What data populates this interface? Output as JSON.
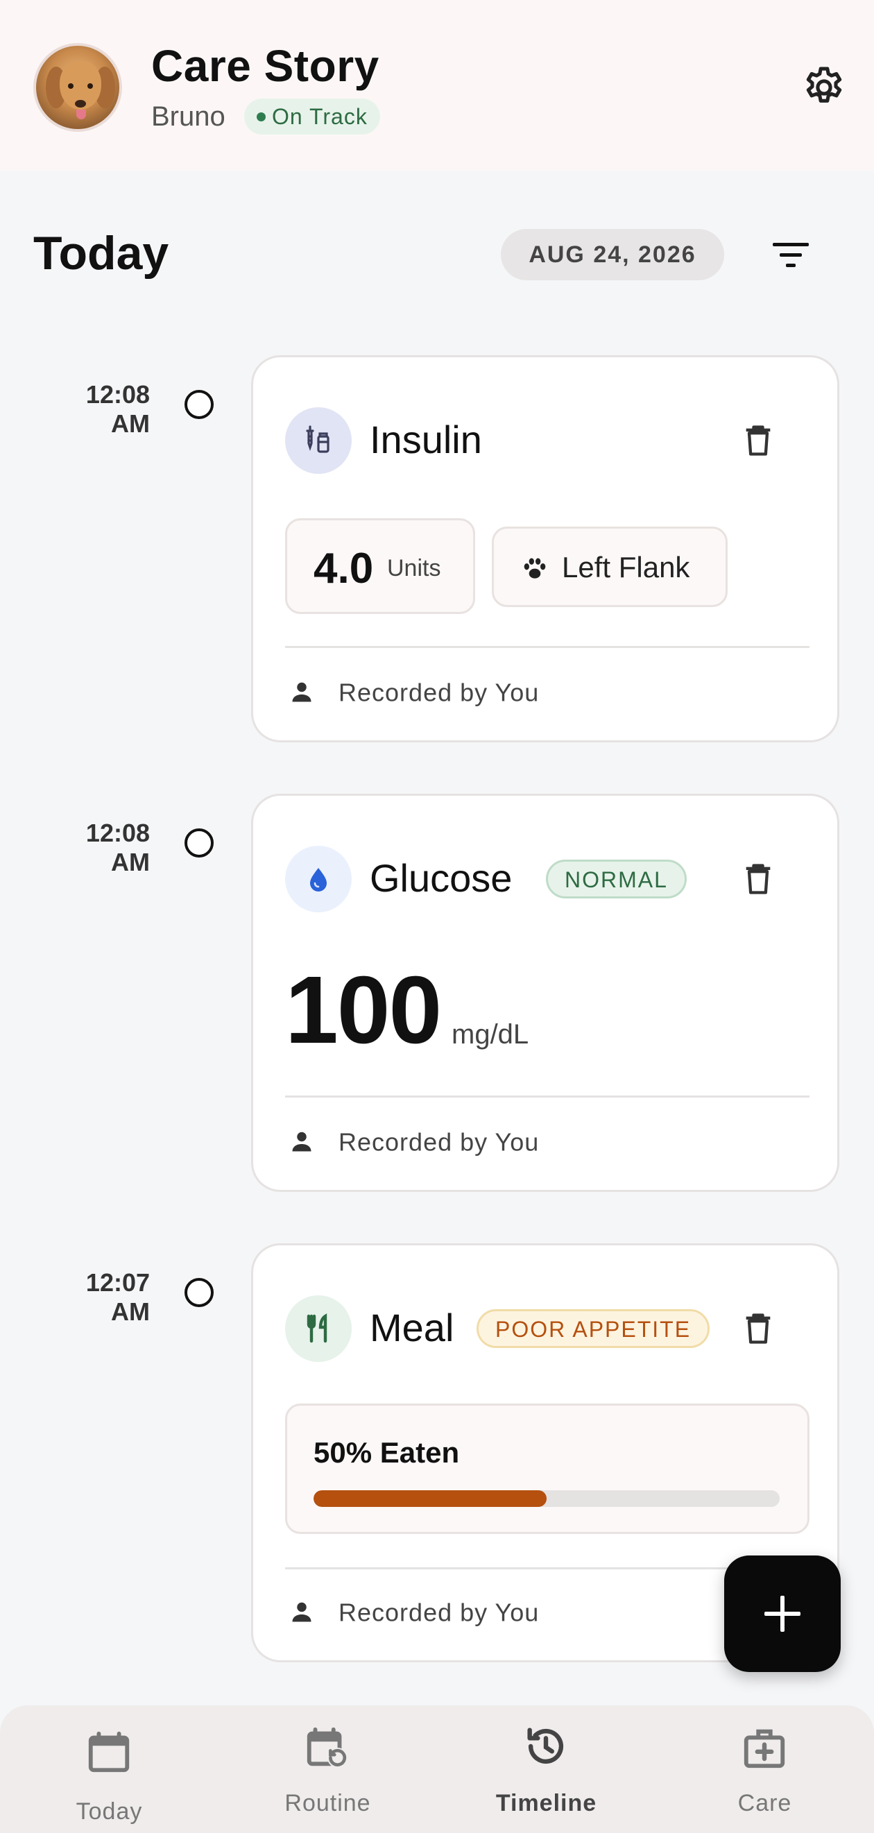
{
  "header": {
    "title": "Care Story",
    "pet_name": "Bruno",
    "status": "On Track",
    "icons": {
      "avatar": "dog-photo",
      "settings": "gear-icon"
    }
  },
  "section": {
    "title": "Today",
    "date": "AUG 24, 2026",
    "icons": {
      "filter": "filter-icon"
    }
  },
  "entries": [
    {
      "time_line1": "12:08",
      "time_line2": "AM",
      "type": "Insulin",
      "icon": "syringe-vial-icon",
      "dose_value": "4.0",
      "dose_unit": "Units",
      "site": "Left Flank",
      "site_icon": "paw-icon",
      "recorded_by": "Recorded by You"
    },
    {
      "time_line1": "12:08",
      "time_line2": "AM",
      "type": "Glucose",
      "icon": "droplet-icon",
      "badge": "NORMAL",
      "value": "100",
      "unit": "mg/dL",
      "recorded_by": "Recorded by You"
    },
    {
      "time_line1": "12:07",
      "time_line2": "AM",
      "type": "Meal",
      "icon": "fork-knife-icon",
      "badge": "POOR APPETITE",
      "eaten_label": "50% Eaten",
      "eaten_fraction": 0.5,
      "recorded_by": "Recorded by You"
    }
  ],
  "fab": {
    "icon": "plus-icon"
  },
  "nav": {
    "items": [
      {
        "label": "Today",
        "icon": "calendar-icon",
        "active": false
      },
      {
        "label": "Routine",
        "icon": "calendar-repeat-icon",
        "active": false
      },
      {
        "label": "Timeline",
        "icon": "history-icon",
        "active": true
      },
      {
        "label": "Care",
        "icon": "medical-kit-icon",
        "active": false
      }
    ]
  },
  "colors": {
    "header_bg": "#fcf7f6",
    "status_green": "#2e6b43",
    "insulin_icon_bg": "#e1e4f4",
    "glucose_icon_bg": "#eaf1fd",
    "glucose_drop": "#2962d9",
    "meal_icon_bg": "#e6f2ea",
    "meal_icon": "#2e6b43",
    "normal_badge": "#2e6b43",
    "appetite_badge": "#b5500f",
    "progress_fill": "#b5500f",
    "fab_bg": "#0a0a0a"
  }
}
